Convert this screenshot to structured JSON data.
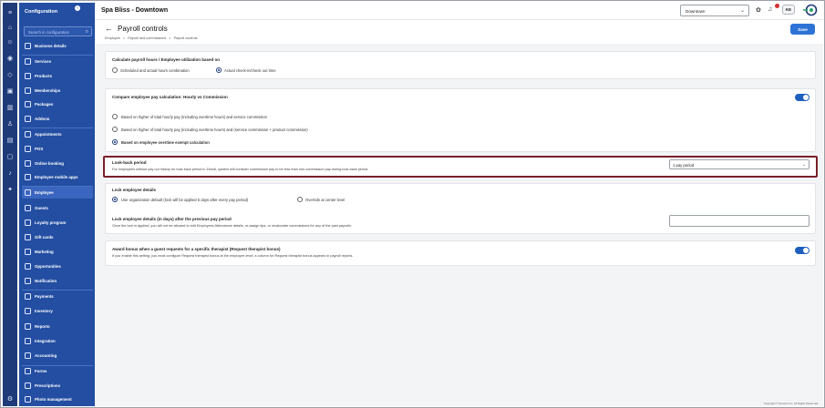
{
  "sidebar": {
    "title": "Configuration",
    "search_placeholder": "Search in configuration",
    "items": [
      {
        "label": "Business details",
        "icon": "building-icon"
      },
      {
        "label": "Services",
        "icon": "services-icon"
      },
      {
        "label": "Products",
        "icon": "products-icon"
      },
      {
        "label": "Memberships",
        "icon": "membership-icon"
      },
      {
        "label": "Packages",
        "icon": "package-icon"
      },
      {
        "label": "Addons",
        "icon": "addon-icon"
      },
      {
        "label": "Appointments",
        "icon": "calendar-icon"
      },
      {
        "label": "POS",
        "icon": "pos-icon"
      },
      {
        "label": "Online booking",
        "icon": "online-booking-icon"
      },
      {
        "label": "Employee mobile apps",
        "icon": "mobile-icon"
      },
      {
        "label": "Employee",
        "icon": "employee-icon"
      },
      {
        "label": "Guests",
        "icon": "guests-icon"
      },
      {
        "label": "Loyalty program",
        "icon": "loyalty-icon"
      },
      {
        "label": "Gift cards",
        "icon": "gift-card-icon"
      },
      {
        "label": "Marketing",
        "icon": "marketing-icon"
      },
      {
        "label": "Opportunities",
        "icon": "opportunities-icon"
      },
      {
        "label": "Notification",
        "icon": "notification-icon"
      },
      {
        "label": "Payments",
        "icon": "payments-icon"
      },
      {
        "label": "Inventory",
        "icon": "inventory-icon"
      },
      {
        "label": "Reports",
        "icon": "reports-icon"
      },
      {
        "label": "Integration",
        "icon": "integration-icon"
      },
      {
        "label": "Accounting",
        "icon": "accounting-icon"
      },
      {
        "label": "Forms",
        "icon": "forms-icon"
      },
      {
        "label": "Prescriptions",
        "icon": "prescription-icon"
      },
      {
        "label": "Photo management",
        "icon": "photo-icon"
      }
    ],
    "active_item": "Employee"
  },
  "header": {
    "store_name": "Spa Bliss - Downtown",
    "location": "Downtown",
    "user_initials": "KE"
  },
  "page": {
    "title": "Payroll controls",
    "breadcrumb": [
      "Employee",
      ">",
      "Payroll and commissions",
      ">",
      "Payroll controls"
    ],
    "save_label": "Save"
  },
  "sections": {
    "hours": {
      "label": "Calculate payroll hours / Employee utilization based on",
      "option1": "Scheduled and actual hours combination",
      "option2": "Actual check-in/check out time",
      "selected": 2
    },
    "compare": {
      "label": "Compare employee pay calculation: Hourly vs Commission",
      "toggle_on": true,
      "option1": "Based on higher of total hourly pay (including overtime hours) and service commission",
      "option2": "Based on higher of total hourly pay (including overtime hours) and (service commission + product commission)",
      "option3": "Based on employee overtime exempt calculation",
      "selected": 3
    },
    "lookback": {
      "label": "Look-back period",
      "description": "For employees without pay out history for look-back period in Zenoti, system will consider commission pay to be less than non-commission pay during look-back period.",
      "value": "1 pay period"
    },
    "lock": {
      "label": "Lock employee details",
      "option1": "Use organization default (lock will be applied 5 days after every pay period)",
      "option2": "Override at center level",
      "selected": 1,
      "days_label": "Lock employee details (in days) after the previous pay period",
      "days_desc": "Once the lock is applied, you will not be allowed to edit Employees Attendance details, re-assign tips, or recalculate commissions for any of the past payrolls.",
      "days_value": ""
    },
    "bonus": {
      "label": "Award bonus when a guest requests for a specific therapist (Request therapist bonus)",
      "description": "If you enable this setting, you must configure Request therapist bonus at the employee level; a column for Request therapist bonus appears in payroll reports.",
      "toggle_on": true
    }
  },
  "footer": "Copyright © Zenoti.com. All Rights Reserved.",
  "colors": {
    "sidebar": "#234ea2",
    "rail": "#1e3a78",
    "accent": "#2d73d6",
    "highlight_border": "#7a1f2b"
  }
}
